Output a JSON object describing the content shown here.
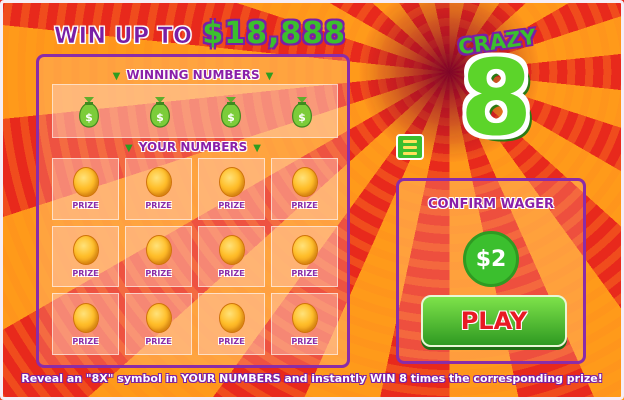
{
  "header": {
    "prefix": "WIN UP TO",
    "amount": "$18,888"
  },
  "logo": {
    "crazy": "CRAZY",
    "eight": "8"
  },
  "board": {
    "winning_label": "WINNING NUMBERS",
    "your_label": "YOUR NUMBERS",
    "winning_symbols": [
      "money-bag-icon",
      "money-bag-icon",
      "money-bag-icon",
      "money-bag-icon"
    ],
    "your_cells": [
      {
        "label": "PRIZE"
      },
      {
        "label": "PRIZE"
      },
      {
        "label": "PRIZE"
      },
      {
        "label": "PRIZE"
      },
      {
        "label": "PRIZE"
      },
      {
        "label": "PRIZE"
      },
      {
        "label": "PRIZE"
      },
      {
        "label": "PRIZE"
      },
      {
        "label": "PRIZE"
      },
      {
        "label": "PRIZE"
      },
      {
        "label": "PRIZE"
      },
      {
        "label": "PRIZE"
      }
    ]
  },
  "wager": {
    "label": "CONFIRM WAGER",
    "value": "$2",
    "play_label": "PLAY"
  },
  "footer": {
    "text": "Reveal an \"8X\" symbol in YOUR NUMBERS and instantly WIN 8 times the corresponding prize!"
  },
  "colors": {
    "accent_purple": "#8a2ca8",
    "accent_green": "#3bbf2e",
    "play_text": "#e81a24"
  }
}
